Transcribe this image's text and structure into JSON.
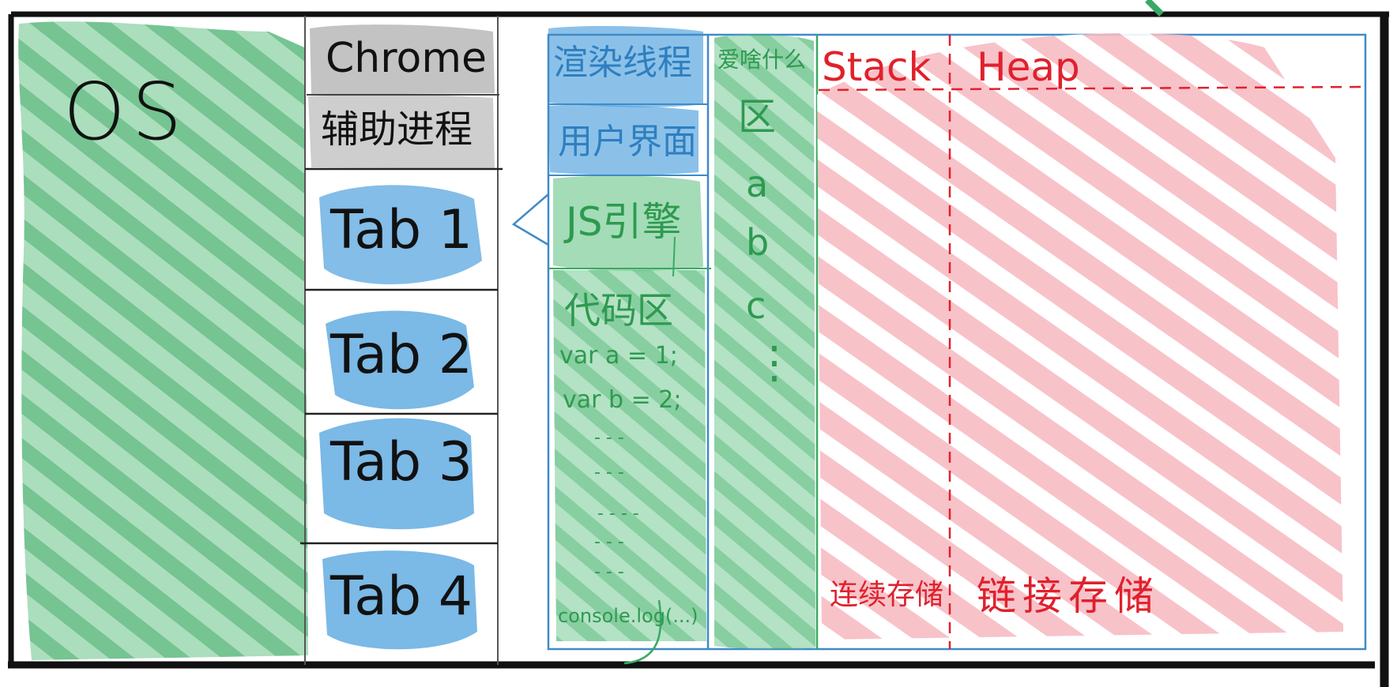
{
  "colors": {
    "frame": "#111111",
    "os_green": "#4caf6e",
    "blue_wash": "#5aa7e0",
    "blue_line": "#3f8bc7",
    "green_line": "#3aa862",
    "green_text": "#2e9a4f",
    "red_wash": "#f3a3ad",
    "red_line": "#e0212c",
    "grey_wash": "#b5b5b5"
  },
  "os": {
    "label": "OS"
  },
  "chrome": {
    "label": "Chrome"
  },
  "helper": {
    "label": "辅助进程"
  },
  "tabs": [
    {
      "label": "Tab 1"
    },
    {
      "label": "Tab 2"
    },
    {
      "label": "Tab 3"
    },
    {
      "label": "Tab 4"
    }
  ],
  "renderer": {
    "render_thread": "渲染线程",
    "ui": "用户界面",
    "js_engine": "JS引擎",
    "code_area": {
      "title": "代码区",
      "lines": [
        "var a = 1;",
        "var b = 2;"
      ],
      "ellipses": [
        "- - -",
        "- - -",
        "- - - -",
        "- - -",
        "- - -"
      ],
      "last_line": "console.log(...)"
    }
  },
  "vars": {
    "title": "爱啥什么",
    "area": "区",
    "items": [
      "a",
      "b",
      "c"
    ],
    "dots": "⋮"
  },
  "memory": {
    "stack": "Stack",
    "heap": "Heap",
    "stack_caption": "连续存储",
    "heap_caption": "链接存储"
  }
}
